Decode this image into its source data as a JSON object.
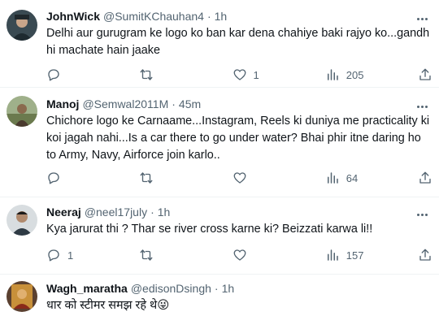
{
  "tweets": [
    {
      "name": "JohnWick",
      "handle": "@SumitKChauhan4",
      "time": "1h",
      "text": "Delhi aur gurugram ke logo ko ban kar dena chahiye baki rajyo ko...gandh hi machate hain jaake",
      "replies": "",
      "retweets": "",
      "likes": "1",
      "views": "205"
    },
    {
      "name": "Manoj",
      "handle": "@Semwal2011M",
      "time": "45m",
      "text": "Chichore logo ke Carnaame...Instagram, Reels ki duniya me practicality ki koi jagah nahi...Is a car there to go under water? Bhai phir itne daring ho to Army, Navy, Airforce join karlo..",
      "replies": "",
      "retweets": "",
      "likes": "",
      "views": "64"
    },
    {
      "name": "Neeraj",
      "handle": "@neel17july",
      "time": "1h",
      "text": "Kya jarurat thi ? Thar se river cross karne ki? Beizzati karwa li!!",
      "replies": "1",
      "retweets": "",
      "likes": "",
      "views": "157"
    },
    {
      "name": "Wagh_maratha",
      "handle": "@edisonDsingh",
      "time": "1h",
      "text": "धार को स्टीमर समझ रहे थे😜"
    }
  ],
  "separator": "·",
  "icons": [
    "more-icon",
    "reply-icon",
    "retweet-icon",
    "like-icon",
    "views-icon",
    "share-icon"
  ],
  "colors": {
    "text": "#0f1419",
    "secondary": "#536471",
    "border": "#eff3f4"
  }
}
